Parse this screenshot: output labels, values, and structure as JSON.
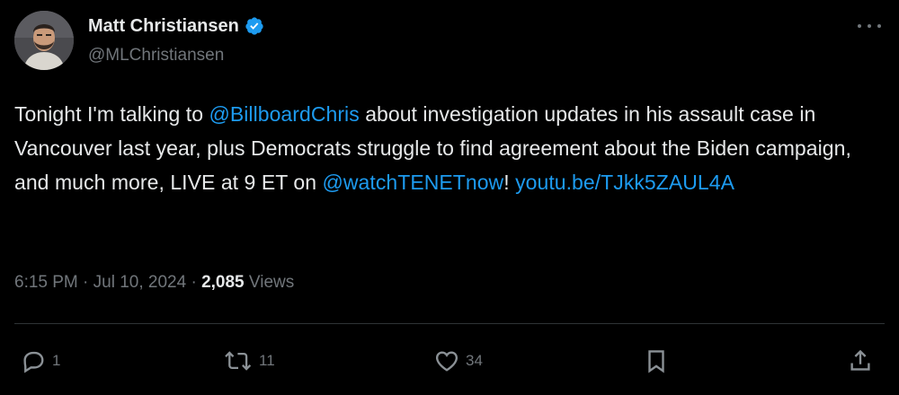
{
  "author": {
    "display_name": "Matt Christiansen",
    "handle": "@MLChristiansen",
    "verified": true
  },
  "tweet": {
    "segments": [
      {
        "type": "text",
        "value": "Tonight I'm talking to "
      },
      {
        "type": "mention",
        "value": "@BillboardChris"
      },
      {
        "type": "text",
        "value": " about investigation updates in his assault case in Vancouver last year, plus Democrats struggle to find agreement about the Biden campaign, and much more, LIVE at 9 ET on "
      },
      {
        "type": "mention",
        "value": "@watchTENETnow"
      },
      {
        "type": "text",
        "value": "! "
      },
      {
        "type": "link",
        "value": "youtu.be/TJkk5ZAUL4A"
      }
    ]
  },
  "meta": {
    "time": "6:15 PM",
    "separator": "·",
    "date": "Jul 10, 2024",
    "views_count": "2,085",
    "views_label": "Views"
  },
  "actions": {
    "reply_count": "1",
    "retweet_count": "11",
    "like_count": "34"
  },
  "colors": {
    "background": "#000000",
    "text": "#e7e9ea",
    "secondary": "#71767b",
    "link": "#1d9bf0",
    "divider": "#2f3336"
  }
}
